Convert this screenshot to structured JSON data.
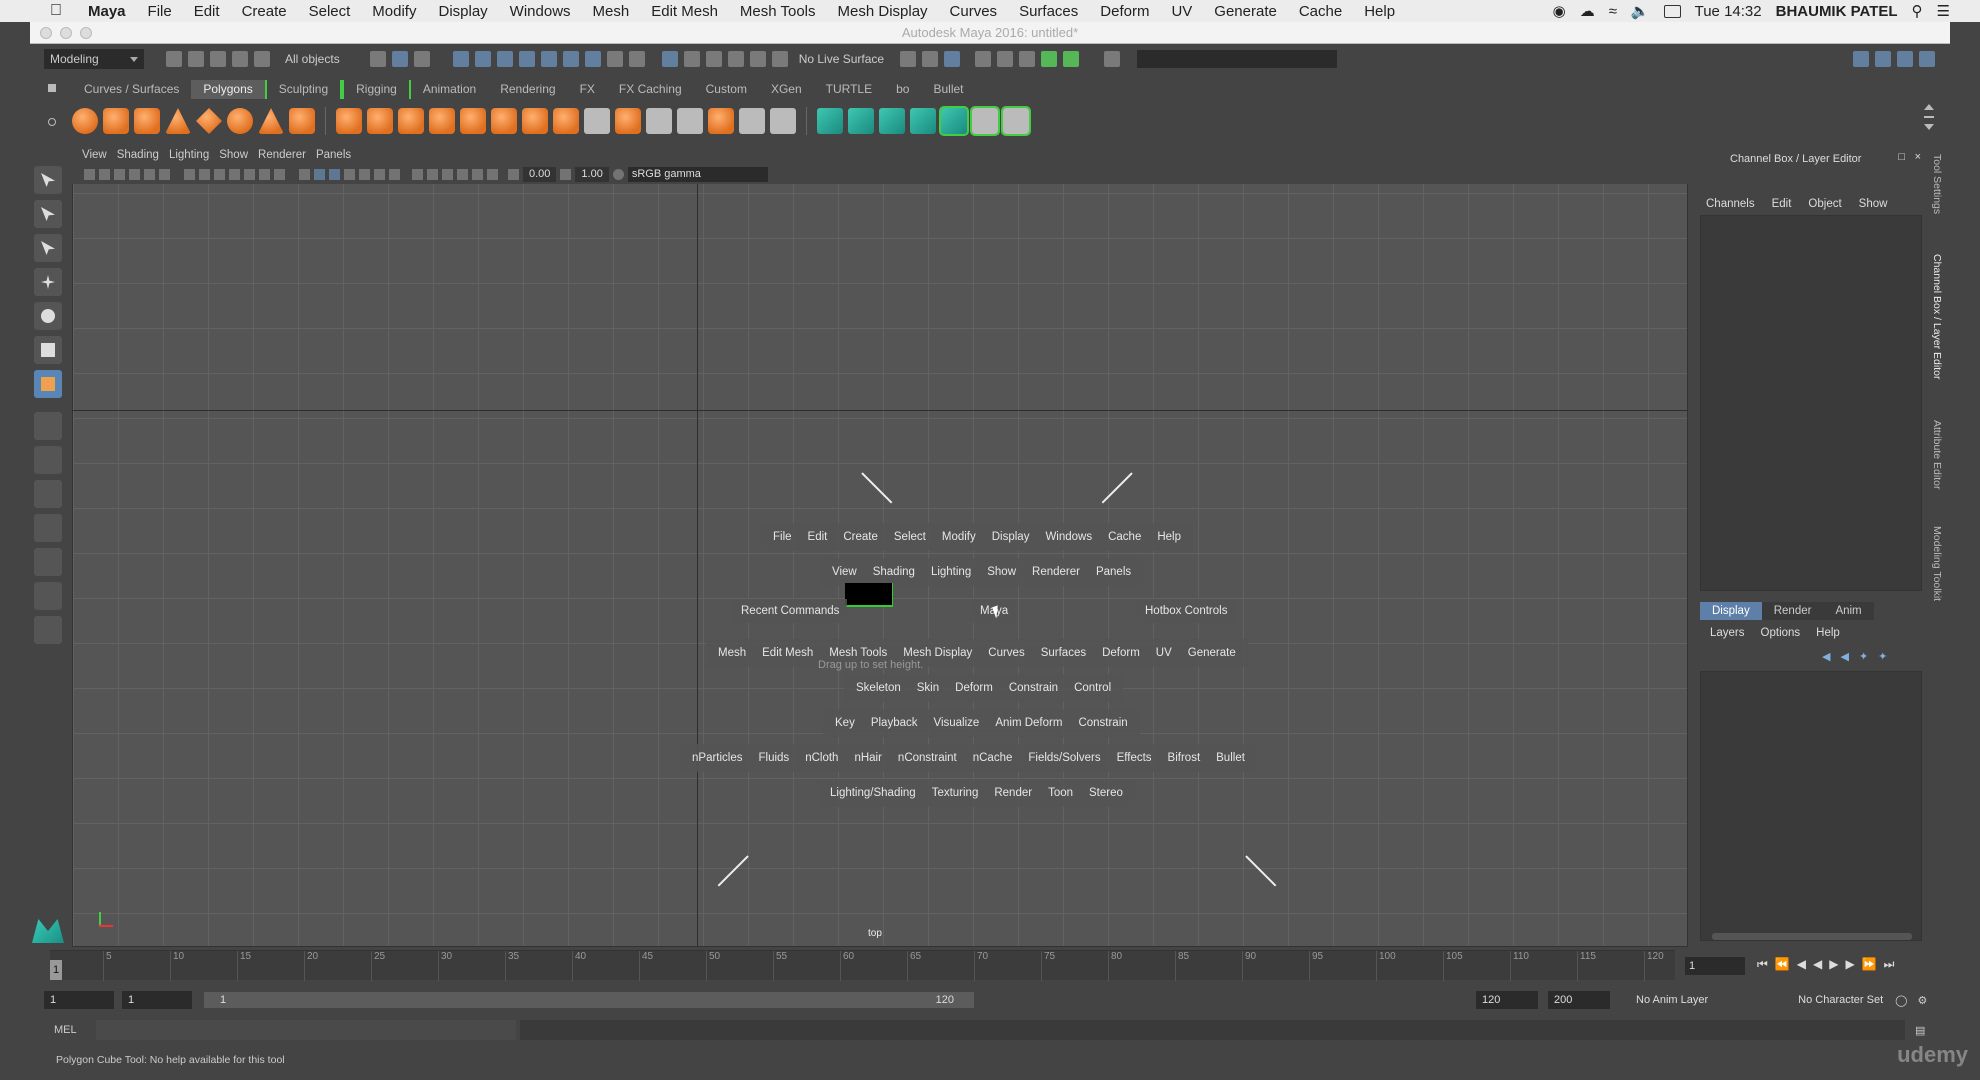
{
  "mac": {
    "menu": [
      "File",
      "Edit",
      "Create",
      "Select",
      "Modify",
      "Display",
      "Windows",
      "Mesh",
      "Edit Mesh",
      "Mesh Tools",
      "Mesh Display",
      "Curves",
      "Surfaces",
      "Deform",
      "UV",
      "Generate",
      "Cache",
      "Help"
    ],
    "app": "Maya",
    "clock": "Tue 14:32",
    "user": "BHAUMIK PATEL"
  },
  "window": {
    "title": "Autodesk Maya 2016: untitled*"
  },
  "status": {
    "menuset": "Modeling",
    "selmode": "All objects",
    "live": "No Live Surface"
  },
  "shelf_tabs": [
    "Curves / Surfaces",
    "Polygons",
    "Sculpting",
    "Rigging",
    "Animation",
    "Rendering",
    "FX",
    "FX Caching",
    "Custom",
    "XGen",
    "TURTLE",
    "bo",
    "Bullet"
  ],
  "panel": {
    "menu": [
      "View",
      "Shading",
      "Lighting",
      "Show",
      "Renderer",
      "Panels"
    ],
    "exposure": "0.00",
    "gamma": "1.00",
    "colorspace": "sRGB gamma",
    "camera": "top"
  },
  "hotbox": {
    "row1": [
      "File",
      "Edit",
      "Create",
      "Select",
      "Modify",
      "Display",
      "Windows",
      "Cache",
      "Help"
    ],
    "row2": [
      "View",
      "Shading",
      "Lighting",
      "Show",
      "Renderer",
      "Panels"
    ],
    "recent": "Recent Commands",
    "center": "Maya",
    "controls": "Hotbox Controls",
    "row4": [
      "Mesh",
      "Edit Mesh",
      "Mesh Tools",
      "Mesh Display",
      "Curves",
      "Surfaces",
      "Deform",
      "UV",
      "Generate"
    ],
    "hint": "Drag up to set height.",
    "row5": [
      "Skeleton",
      "Skin",
      "Deform",
      "Constrain",
      "Control"
    ],
    "row6": [
      "Key",
      "Playback",
      "Visualize",
      "Anim Deform",
      "Constrain"
    ],
    "row7": [
      "nParticles",
      "Fluids",
      "nCloth",
      "nHair",
      "nConstraint",
      "nCache",
      "Fields/Solvers",
      "Effects",
      "Bifrost",
      "Bullet"
    ],
    "row8": [
      "Lighting/Shading",
      "Texturing",
      "Render",
      "Toon",
      "Stereo"
    ]
  },
  "channelbox": {
    "title": "Channel Box / Layer Editor",
    "menu": [
      "Channels",
      "Edit",
      "Object",
      "Show"
    ]
  },
  "layereditor": {
    "tabs": [
      "Display",
      "Render",
      "Anim"
    ],
    "menu": [
      "Layers",
      "Options",
      "Help"
    ]
  },
  "sidetabs": [
    "Tool Settings",
    "Channel Box / Layer Editor",
    "Attribute Editor",
    "Modeling Toolkit"
  ],
  "timeline": {
    "ticks": [
      "5",
      "10",
      "15",
      "20",
      "25",
      "30",
      "35",
      "40",
      "45",
      "50",
      "55",
      "60",
      "65",
      "70",
      "75",
      "80",
      "85",
      "90",
      "95",
      "100",
      "105",
      "110",
      "115",
      "120"
    ],
    "current": "1",
    "frame_field": "1"
  },
  "range": {
    "start": "1",
    "start2": "1",
    "bar_start": "1",
    "bar_end": "120",
    "end": "120",
    "end2": "200",
    "anim_layer": "No Anim Layer",
    "char_set": "No Character Set"
  },
  "cmd": {
    "lang": "MEL"
  },
  "help": "Polygon Cube Tool: No help available for this tool",
  "watermark": "udemy"
}
